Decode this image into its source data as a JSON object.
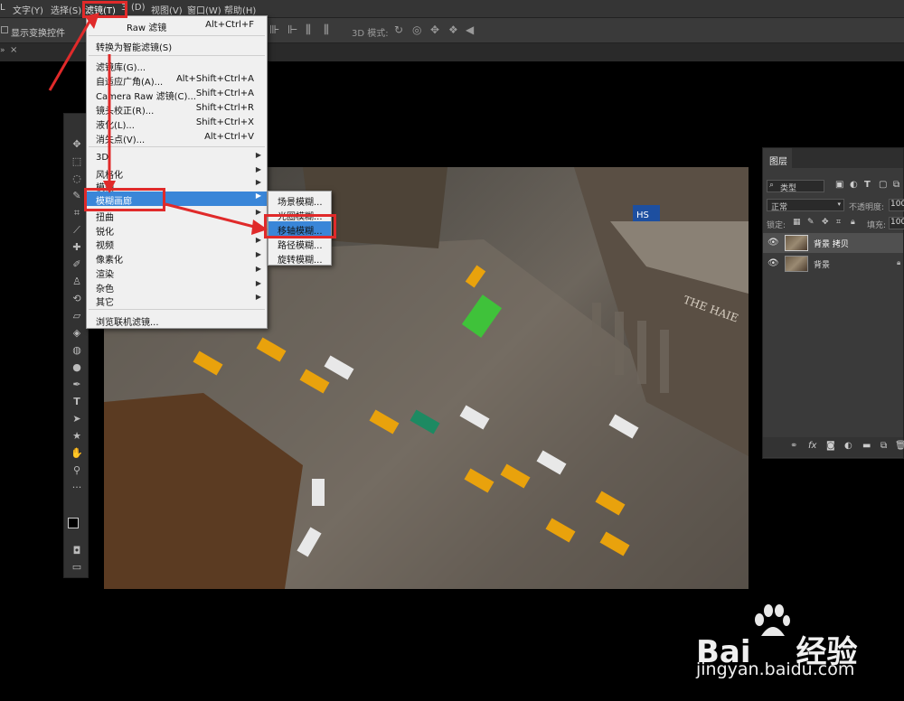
{
  "menubar": {
    "items": [
      {
        "label": "L"
      },
      {
        "label": "文字(Y)"
      },
      {
        "label": "选择(S)"
      },
      {
        "label": "滤镜(T)"
      },
      {
        "label": "3"
      },
      {
        "label": "(D)"
      },
      {
        "label": "视图(V)"
      },
      {
        "label": "窗口(W)"
      },
      {
        "label": "帮助(H)"
      }
    ]
  },
  "optbar": {
    "show_transform_label": "显示变换控件",
    "mode_3d_label": "3D 模式:"
  },
  "tab": {
    "close": "×"
  },
  "filter_menu": {
    "items": [
      {
        "label": "Raw 滤镜",
        "shortcut": "Alt+Ctrl+F"
      },
      {
        "label": "转换为智能滤镜(S)",
        "shortcut": ""
      },
      {
        "label": "滤镜库(G)...",
        "shortcut": ""
      },
      {
        "label": "自适应广角(A)...",
        "shortcut": "Alt+Shift+Ctrl+A"
      },
      {
        "label": "Camera Raw 滤镜(C)...",
        "shortcut": "Shift+Ctrl+A"
      },
      {
        "label": "镜头校正(R)...",
        "shortcut": "Shift+Ctrl+R"
      },
      {
        "label": "液化(L)...",
        "shortcut": "Shift+Ctrl+X"
      },
      {
        "label": "消失点(V)...",
        "shortcut": "Alt+Ctrl+V"
      },
      {
        "label": "3D",
        "shortcut": ""
      },
      {
        "label": "风格化",
        "shortcut": ""
      },
      {
        "label": "模糊",
        "shortcut": ""
      },
      {
        "label": "模糊画廊",
        "shortcut": ""
      },
      {
        "label": "扭曲",
        "shortcut": ""
      },
      {
        "label": "锐化",
        "shortcut": ""
      },
      {
        "label": "视频",
        "shortcut": ""
      },
      {
        "label": "像素化",
        "shortcut": ""
      },
      {
        "label": "渲染",
        "shortcut": ""
      },
      {
        "label": "杂色",
        "shortcut": ""
      },
      {
        "label": "其它",
        "shortcut": ""
      },
      {
        "label": "浏览联机滤镜...",
        "shortcut": ""
      }
    ]
  },
  "blur_gallery_submenu": {
    "items": [
      {
        "label": "场景模糊..."
      },
      {
        "label": "光圈模糊..."
      },
      {
        "label": "移轴模糊..."
      },
      {
        "label": "路径模糊..."
      },
      {
        "label": "旋转模糊..."
      }
    ]
  },
  "layers_panel": {
    "title": "图层",
    "filter_kind": "类型",
    "blend_mode": "正常",
    "opacity_label": "不透明度:",
    "opacity_value": "100",
    "lock_label": "锁定:",
    "fill_label": "填充:",
    "fill_value": "100",
    "layers": [
      {
        "name": "背景 拷贝"
      },
      {
        "name": "背景"
      }
    ],
    "footer_fx": "fx"
  },
  "canvas": {
    "sign_text": "THE HAIE",
    "sign_small": "HS"
  },
  "watermark": {
    "brand_a": "Bai",
    "brand_b": "经验",
    "url": "jingyan.baidu.com"
  },
  "colors": {
    "accent_red": "#e02a2a",
    "menu_highlight": "#3a86d8",
    "submenu_highlight": "#3a86d8"
  }
}
